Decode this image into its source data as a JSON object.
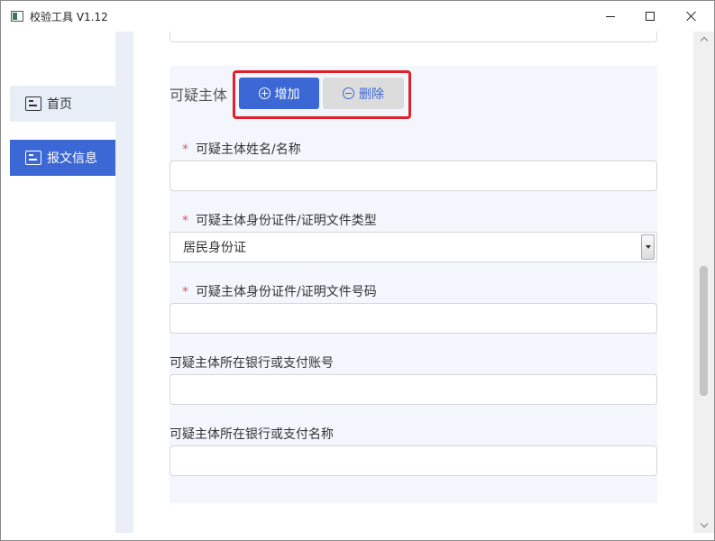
{
  "window": {
    "title": "校验工具 V1.12",
    "icons": {
      "app": "app-window-icon",
      "minimize": "minimize-icon",
      "maximize": "maximize-icon",
      "close": "close-icon"
    }
  },
  "sidebar": {
    "items": [
      {
        "label": "首页",
        "icon": "document-icon",
        "active": false
      },
      {
        "label": "报文信息",
        "icon": "document-icon",
        "active": true
      }
    ]
  },
  "section": {
    "title": "可疑主体",
    "add_label": "增加",
    "delete_label": "删除"
  },
  "fields": {
    "name": {
      "label": "可疑主体姓名/名称",
      "required": "*",
      "value": ""
    },
    "id_type": {
      "label": "可疑主体身份证件/证明文件类型",
      "required": "*",
      "value": "居民身份证"
    },
    "id_number": {
      "label": "可疑主体身份证件/证明文件号码",
      "required": "*",
      "value": ""
    },
    "account": {
      "label": "可疑主体所在银行或支付账号",
      "value": ""
    },
    "bank_name": {
      "label": "可疑主体所在银行或支付名称",
      "value": ""
    }
  },
  "colors": {
    "accent": "#3b68d4",
    "highlight": "#e0212a",
    "required": "#e0565c",
    "panel_bg": "#f3f6fc"
  }
}
